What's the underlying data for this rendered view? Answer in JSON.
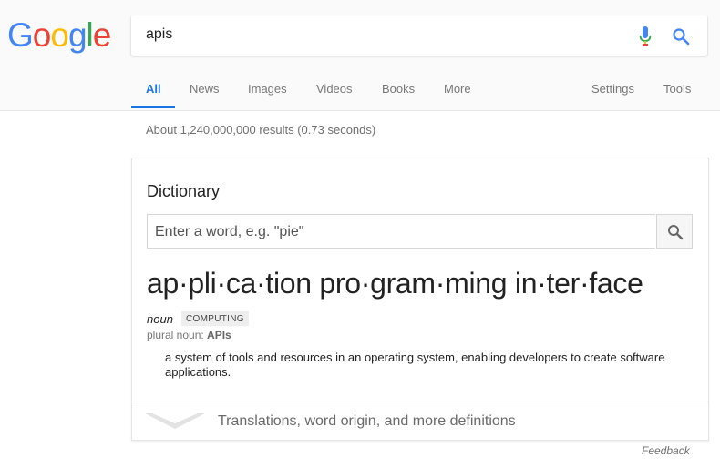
{
  "logo": {
    "text": "Google",
    "letters": [
      {
        "ch": "G",
        "color": "#4285F4"
      },
      {
        "ch": "o",
        "color": "#EA4335"
      },
      {
        "ch": "o",
        "color": "#FBBC05"
      },
      {
        "ch": "g",
        "color": "#4285F4"
      },
      {
        "ch": "l",
        "color": "#34A853"
      },
      {
        "ch": "e",
        "color": "#EA4335"
      }
    ]
  },
  "search": {
    "query": "apis",
    "mic_icon": "microphone-icon",
    "search_icon": "search-icon"
  },
  "tabs": {
    "all": "All",
    "news": "News",
    "images": "Images",
    "videos": "Videos",
    "books": "Books",
    "more": "More",
    "settings": "Settings",
    "tools": "Tools"
  },
  "results_count": "About 1,240,000,000 results (0.73 seconds)",
  "dictionary": {
    "title": "Dictionary",
    "input_placeholder": "Enter a word, e.g. \"pie\"",
    "headword": "ap·pli·ca·tion pro·gram·ming in·ter·face",
    "part_of_speech": "noun",
    "domain": "COMPUTING",
    "plural_label": "plural noun: ",
    "plural_value": "APIs",
    "definition": "a system of tools and resources in an operating system, enabling developers to create software applications.",
    "more_link": "Translations, word origin, and more definitions"
  },
  "feedback": "Feedback",
  "colors": {
    "accent": "#1a73e8"
  }
}
